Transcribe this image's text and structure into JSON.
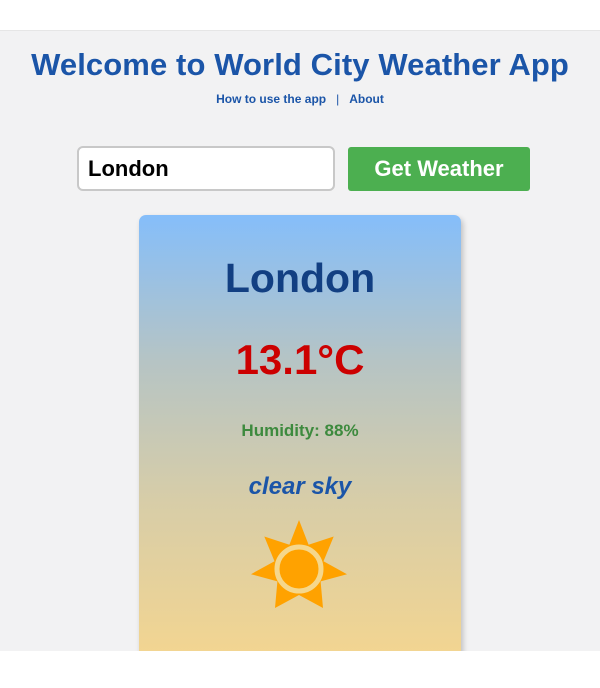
{
  "header": {
    "title": "Welcome to World City Weather App",
    "nav": {
      "how_to": "How to use the app",
      "separator": "|",
      "about": "About"
    }
  },
  "search": {
    "value": "London",
    "button_label": "Get Weather"
  },
  "weather": {
    "city": "London",
    "temperature": "13.1°C",
    "humidity": "Humidity: 88%",
    "description": "clear sky",
    "icon": "sun-icon"
  },
  "colors": {
    "title": "#1b55a8",
    "button": "#4caf50",
    "temperature": "#cc0000",
    "humidity": "#3d8a3e",
    "sun": "#ffa200"
  }
}
